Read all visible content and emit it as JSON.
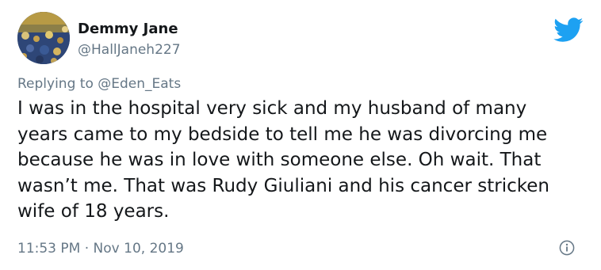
{
  "author": {
    "display_name": "Demmy Jane",
    "handle": "@HallJaneh227"
  },
  "reply": {
    "prefix": "Replying to ",
    "mention": "@Eden_Eats"
  },
  "tweet": {
    "text": "I was in the hospital very sick and my husband of many years came to my bedside to tell me he was divorcing me because he was in love with someone else. Oh wait. That wasn’t me. That was Rudy Giuliani and his cancer stricken wife of 18 years."
  },
  "meta": {
    "time": "11:53 PM",
    "separator": " · ",
    "date": "Nov 10, 2019"
  },
  "icons": {
    "brand": "twitter-bird-icon",
    "info": "info-icon"
  },
  "colors": {
    "brand_blue": "#1da1f2",
    "secondary_text": "#657786",
    "primary_text": "#14171a"
  }
}
